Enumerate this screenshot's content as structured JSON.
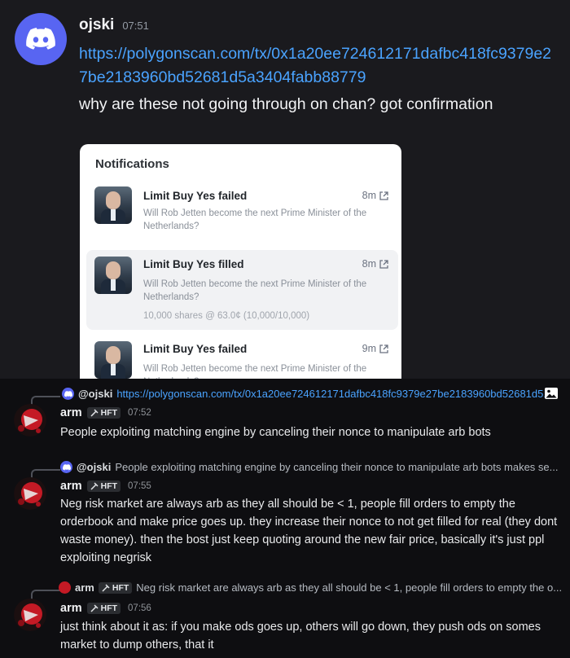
{
  "top_message": {
    "author": "ojski",
    "time": "07:51",
    "link": "https://polygonscan.com/tx/0x1a20ee724612171dafbc418fc9379e27be2183960bd52681d5a3404fabb88779",
    "text": "why are these not going through on chan? got confirmation"
  },
  "notifications": {
    "title": "Notifications",
    "items": [
      {
        "heading": "Limit Buy Yes failed",
        "time": "8m",
        "subtitle": "Will Rob Jetten become the next Prime Minister of the Netherlands?",
        "extra": ""
      },
      {
        "heading": "Limit Buy Yes filled",
        "time": "8m",
        "subtitle": "Will Rob Jetten become the next Prime Minister of the Netherlands?",
        "extra": "10,000 shares @ 63.0¢ (10,000/10,000)"
      },
      {
        "heading": "Limit Buy Yes failed",
        "time": "9m",
        "subtitle": "Will Rob Jetten become the next Prime Minister of the Netherlands?",
        "extra": ""
      }
    ]
  },
  "thread": [
    {
      "reply_name": "@ojski",
      "reply_text": "https://polygonscan.com/tx/0x1a20ee724612171dafbc418fc9379e27be2183960bd52681d5...",
      "author": "arm",
      "tag": "HFT",
      "time": "07:52",
      "text": "People exploiting matching engine by canceling their nonce to manipulate arb bots"
    },
    {
      "reply_name": "@ojski",
      "reply_text": "People exploiting matching engine by canceling their nonce to manipulate arb bots  makes se...",
      "author": "arm",
      "tag": "HFT",
      "time": "07:55",
      "text": "Neg risk market are always arb as they all should be < 1, people fill orders to empty the orderbook and make price goes up. they increase their nonce to not get filled for real (they dont waste money). then the bost just keep quoting around the new fair price, basically it's just ppl exploiting negrisk"
    },
    {
      "reply_name": "arm",
      "reply_tag": "HFT",
      "reply_text": "Neg risk market are always arb as they all should be < 1, people fill orders to empty the o...",
      "author": "arm",
      "tag": "HFT",
      "time": "07:56",
      "text": "just think about it as: if you make ods goes up, others will go down, they push ods on somes market to dump others, that it"
    }
  ],
  "colors": {
    "link": "#4aa3ff",
    "discord_brand": "#5865f2",
    "arm_avatar": "#c41a25"
  },
  "icons": [
    "discord-icon",
    "external-link-icon",
    "image-icon",
    "hft-tag-icon"
  ]
}
